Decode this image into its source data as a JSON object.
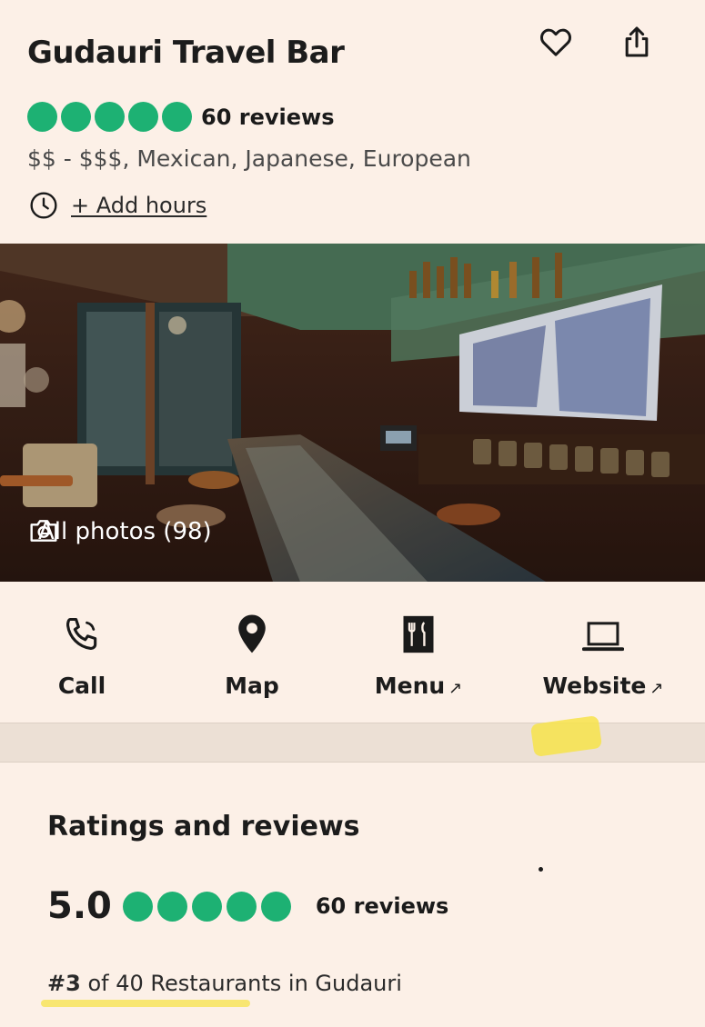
{
  "listing": {
    "name": "Gudauri Travel Bar",
    "rating_dots": 5,
    "review_count": "60 reviews",
    "meta": "$$ - $$$, Mexican, Japanese, European",
    "add_hours_label": "+ Add hours"
  },
  "photo": {
    "all_photos_label": "All photos (98)"
  },
  "actions": [
    {
      "label": "Call",
      "icon": "phone-icon"
    },
    {
      "label": "Map",
      "icon": "map-pin-icon"
    },
    {
      "label": "Menu",
      "icon": "menu-icon",
      "external": "↗"
    },
    {
      "label": "Website",
      "icon": "laptop-icon",
      "external": "↗"
    }
  ],
  "ratings": {
    "heading": "Ratings and reviews",
    "score": "5.0",
    "review_count": "60 reviews",
    "rank_number": "#3",
    "rank_rest": " of 40 Restaurants in Gudauri"
  },
  "colors": {
    "rating_green": "#1db173",
    "background": "#fcf0e7",
    "highlight": "#f7e34a"
  }
}
